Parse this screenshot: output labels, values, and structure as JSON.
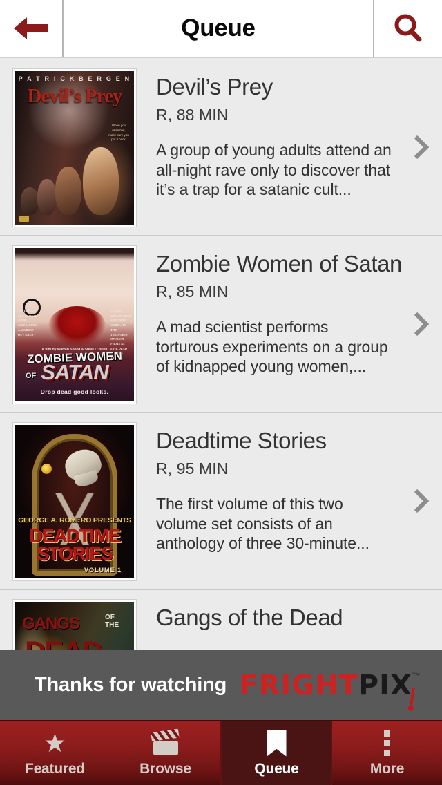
{
  "header": {
    "title": "Queue",
    "back_icon": "back-arrow-icon",
    "search_icon": "search-icon",
    "accent_color": "#8B1A1A"
  },
  "list": {
    "chevron_icon": "chevron-right-icon",
    "items": [
      {
        "title": "Devil’s Prey",
        "meta": "R, 88 MIN",
        "description": "A group of young adults attend an all-night rave only to discover that it’s a trap for a satanic cult...",
        "poster": {
          "credits": "P A T R I C K     B E R G E N",
          "title": "Devil’s Prey",
          "tagline": "When you raise hell, make sure you put it back."
        }
      },
      {
        "title": "Zombie Women of Satan",
        "meta": "R, 85 MIN",
        "description": "A mad scientist performs torturous experiments on a group of kidnapped young women,...",
        "poster": {
          "quote_left": "“THE MUST SEE ZOMBIE FILM... GIRLS, GORE and GROSS-OUT GAGS”",
          "quote_right": "“FUNNY, IMAGINATIVE AND VERY GORY ... IN THE TRADITION OF SUCH FILMS AS EVIL DEAD and BAD TASTE”",
          "credit": "A film by Warren Speed & Steve O’Brien",
          "title_line1": "ZOMBIE WOMEN",
          "title_of": "OF",
          "title_line2": "SATAN",
          "tagline": "Drop dead good looks."
        }
      },
      {
        "title": "Deadtime Stories",
        "meta": "R, 95 MIN",
        "description": "The first volume of this two volume set consists of an anthology of three 30-minute...",
        "poster": {
          "presents": "GEORGE A. ROMERO PRESENTS",
          "title_line1": "DEADTIME",
          "title_line2": "STORIES",
          "volume": "VOLUME 1"
        }
      },
      {
        "title": "Gangs of the Dead",
        "meta": "",
        "description": "",
        "poster": {
          "title_line1": "GANGS",
          "title_small": "OF\nTHE",
          "title_line2": "DEAD"
        }
      }
    ]
  },
  "ad": {
    "text": "Thanks for watching",
    "logo_part1": "FRIGHT",
    "logo_part2": "PIX",
    "trademark": "™",
    "bg_color": "#595959",
    "logo_red": "#cc2222"
  },
  "tabbar": {
    "tabs": [
      {
        "label": "Featured",
        "icon": "star-icon",
        "active": false
      },
      {
        "label": "Browse",
        "icon": "clapperboard-icon",
        "active": false
      },
      {
        "label": "Queue",
        "icon": "bookmark-icon",
        "active": true
      },
      {
        "label": "More",
        "icon": "overflow-dots-icon",
        "active": false
      }
    ],
    "active_bg": "#4a1414"
  }
}
